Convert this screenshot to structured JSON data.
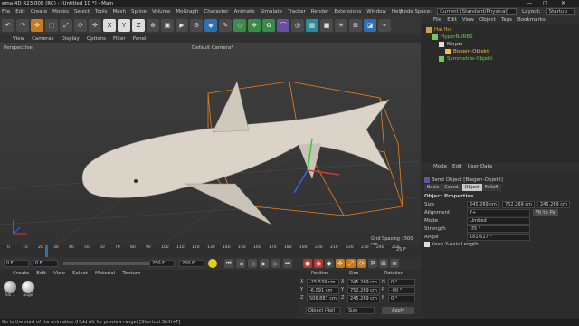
{
  "title": "ema 4D R23.008 (RC) - [Untitled 10 *] - Main",
  "menu": [
    "File",
    "Edit",
    "Create",
    "Modes",
    "Select",
    "Tools",
    "Mesh",
    "Spline",
    "Volume",
    "MoGraph",
    "Character",
    "Animate",
    "Simulate",
    "Tracker",
    "Render",
    "Extensions",
    "Window",
    "Help"
  ],
  "node_space_label": "Node Space:",
  "node_space_value": "Current (Standard/Physical)",
  "layout_label": "Layout:",
  "layout_value": "Startup",
  "vp_menu": [
    "View",
    "Cameras",
    "Display",
    "Options",
    "Filter",
    "Panel"
  ],
  "vp_perspective": "Perspective",
  "vp_camera": "Default Camera*",
  "vp_grid": "Grid Spacing : 500 cm",
  "toolbar_xyz": [
    "X",
    "Y",
    "Z"
  ],
  "timeline_ticks": [
    "0",
    "10",
    "20",
    "30",
    "40",
    "50",
    "60",
    "70",
    "80",
    "90",
    "100",
    "110",
    "120",
    "130",
    "140",
    "150",
    "160",
    "170",
    "180",
    "190",
    "200",
    "210",
    "220",
    "230",
    "240",
    "250"
  ],
  "timeline_end": "25 F",
  "transport": {
    "start": "0 F",
    "cur": "0 F",
    "end1": "250 F",
    "end2": "250 F"
  },
  "mat_menu": [
    "Create",
    "Edit",
    "View",
    "Select",
    "Material",
    "Texture"
  ],
  "materials": [
    "hai 1",
    "auge"
  ],
  "coord": {
    "headers": [
      "Position",
      "Size",
      "Rotation"
    ],
    "rows": [
      [
        "X",
        "-25.539 cm",
        "X",
        "245.269 cm",
        "H",
        "0 °"
      ],
      [
        "Y",
        "-6.091 cm",
        "Y",
        "752.269 cm",
        "P",
        "-90 °"
      ],
      [
        "Z",
        "506.887 cm",
        "Z",
        "245.269 cm",
        "B",
        "0 °"
      ]
    ],
    "mode": "Object (Rel)",
    "size_mode": "Size",
    "apply": "Apply"
  },
  "obj_menu": [
    "File",
    "Edit",
    "View",
    "Object",
    "Tags",
    "Bookmarks"
  ],
  "objects": [
    {
      "name": "Hai.fbx",
      "color": "#cfa14a",
      "indent": 0
    },
    {
      "name": "HyperNURBS",
      "color": "#6acb5c",
      "indent": 1
    },
    {
      "name": "Körper",
      "color": "#e0e0e0",
      "indent": 2
    },
    {
      "name": "Biegen-Objekt",
      "color": "#f0c040",
      "indent": 3
    },
    {
      "name": "Symmetrie-Objekt",
      "color": "#6acb5c",
      "indent": 2
    }
  ],
  "attr_menu": [
    "Mode",
    "Edit",
    "User Data"
  ],
  "attr_title": "Bend Object [Biegen-Objekt]",
  "attr_tabs": [
    "Basic",
    "Coord.",
    "Object",
    "Falloff"
  ],
  "attr_section": "Object Properties",
  "attr_rows": [
    {
      "label": "Size",
      "v": [
        "245.269 cm",
        "752.269 cm",
        "245.269 cm"
      ]
    },
    {
      "label": "Alignment",
      "v": [
        "Y+"
      ],
      "btn": "Fit to Pa"
    },
    {
      "label": "Mode",
      "v": [
        "Limited"
      ]
    },
    {
      "label": "Strength",
      "v": [
        "-35 °"
      ]
    },
    {
      "label": "Angle",
      "v": [
        "181.617 °"
      ]
    }
  ],
  "attr_keep": "Keep Y-Axis Length",
  "status": "Go to the start of the animation (Hold Alt for preview range) [Shortcut Shift+F]",
  "colors": {
    "accent": "#2e6fb0",
    "active": "#e38a1f",
    "bbox": "#e6821e"
  }
}
